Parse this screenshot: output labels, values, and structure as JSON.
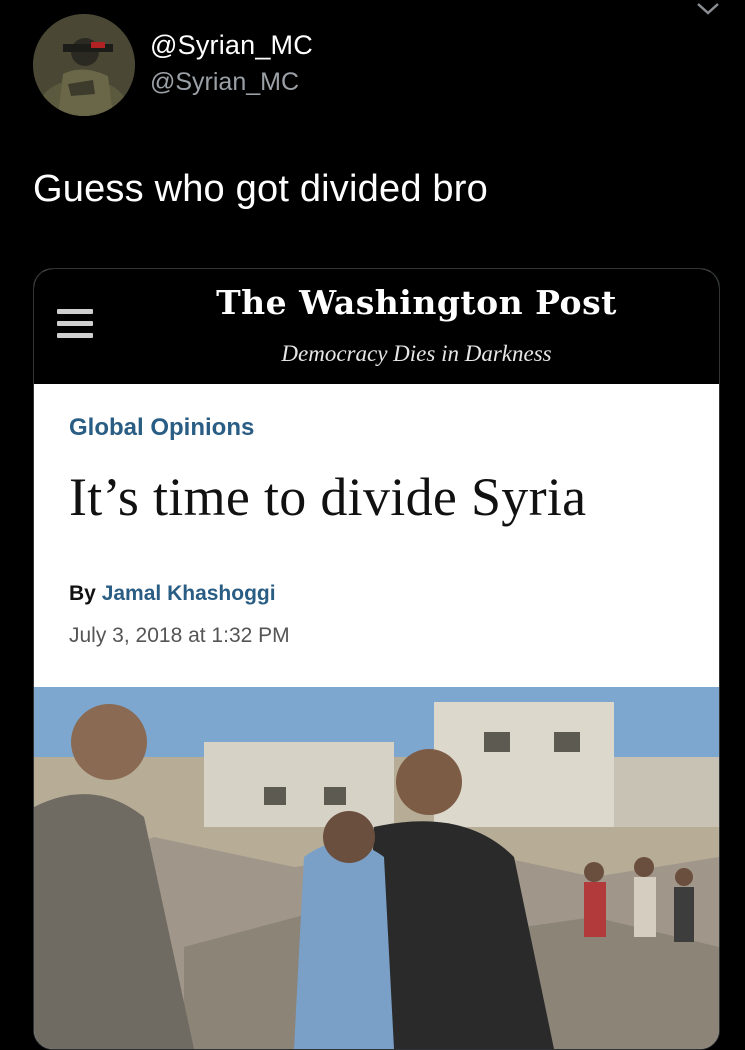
{
  "tweet": {
    "display_name": "@Syrian_MC",
    "handle": "@Syrian_MC",
    "text": "Guess who got divided bro",
    "avatar_icon": "soldier-avatar",
    "menu_icon": "chevron-down-icon"
  },
  "card": {
    "publication": "The Washington Post",
    "tagline": "Democracy Dies in Darkness",
    "menu_icon": "hamburger-menu-icon",
    "section": "Global Opinions",
    "headline": "It’s time to divide Syria",
    "byline_prefix": "By",
    "author": "Jamal Khashoggi",
    "timestamp": "July 3, 2018 at 1:32 PM",
    "photo": "photo-rubble-rescue"
  },
  "colors": {
    "background": "#000000",
    "text": "#ffffff",
    "handle_gray": "#9aa0a6",
    "section_blue": "#2a5d84"
  }
}
